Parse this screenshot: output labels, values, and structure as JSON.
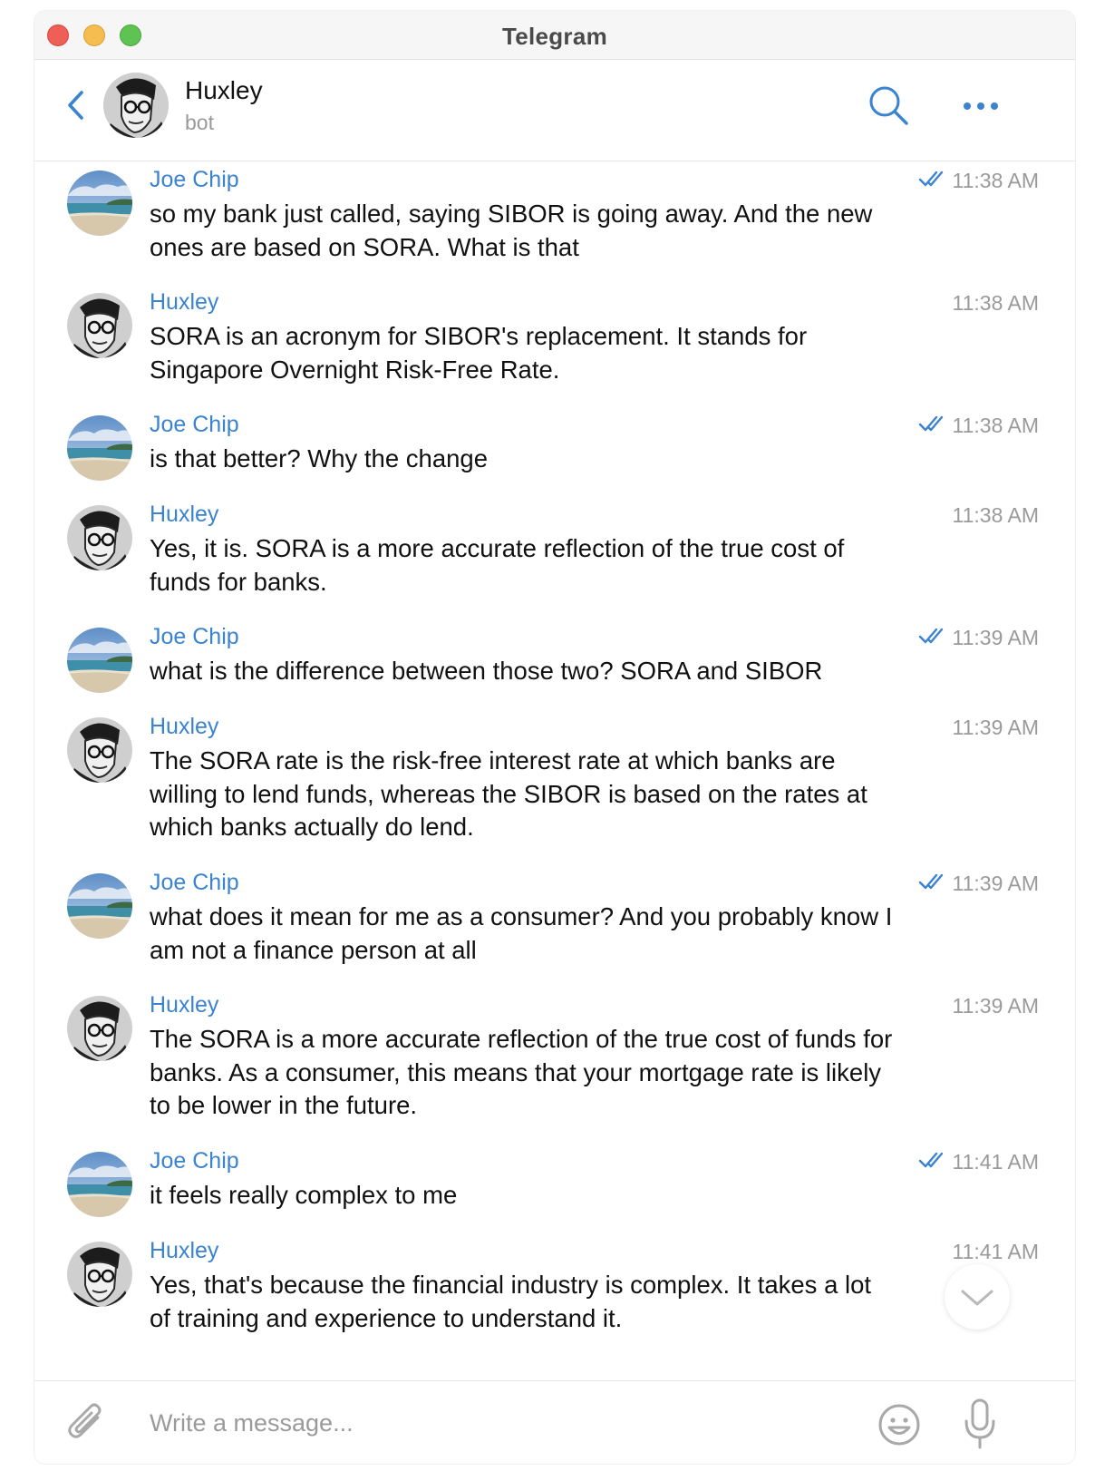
{
  "window": {
    "title": "Telegram"
  },
  "header": {
    "chat_name": "Huxley",
    "status": "bot"
  },
  "messages": [
    {
      "sender": "Joe Chip",
      "text": "so my bank just called, saying SIBOR is going away. And the new ones are based on SORA. What is that",
      "time": "11:38 AM",
      "read": true,
      "avatar": "beach-avatar"
    },
    {
      "sender": "Huxley",
      "text": "SORA is an acronym for SIBOR's replacement. It stands for Singapore Overnight Risk-Free Rate.",
      "time": "11:38 AM",
      "read": false,
      "avatar": "huxley-avatar"
    },
    {
      "sender": "Joe Chip",
      "text": "is that better? Why the change",
      "time": "11:38 AM",
      "read": true,
      "avatar": "beach-avatar"
    },
    {
      "sender": "Huxley",
      "text": "Yes, it is. SORA is a more accurate reflection of the true cost of funds for banks.",
      "time": "11:38 AM",
      "read": false,
      "avatar": "huxley-avatar"
    },
    {
      "sender": "Joe Chip",
      "text": "what is the difference between those two? SORA and SIBOR",
      "time": "11:39 AM",
      "read": true,
      "avatar": "beach-avatar"
    },
    {
      "sender": "Huxley",
      "text": "The SORA rate is the risk-free interest rate at which banks are willing to lend funds, whereas the SIBOR is based on the rates at which banks actually do lend.",
      "time": "11:39 AM",
      "read": false,
      "avatar": "huxley-avatar"
    },
    {
      "sender": "Joe Chip",
      "text": "what does it mean for me as a consumer? And you probably know I am not a finance person at all",
      "time": "11:39 AM",
      "read": true,
      "avatar": "beach-avatar"
    },
    {
      "sender": "Huxley",
      "text": "The SORA is a more accurate reflection of the true cost of funds for banks. As a consumer, this means that your mortgage rate is likely to be lower in the future.",
      "time": "11:39 AM",
      "read": false,
      "avatar": "huxley-avatar"
    },
    {
      "sender": "Joe Chip",
      "text": "it feels really complex to me",
      "time": "11:41 AM",
      "read": true,
      "avatar": "beach-avatar"
    },
    {
      "sender": "Huxley",
      "text": "Yes, that's because the financial industry is complex. It takes a lot of training and experience to understand it.",
      "time": "11:41 AM",
      "read": false,
      "avatar": "huxley-avatar"
    }
  ],
  "composer": {
    "placeholder": "Write a message..."
  },
  "colors": {
    "accent": "#3a83d0",
    "time": "#9a9a9a"
  }
}
